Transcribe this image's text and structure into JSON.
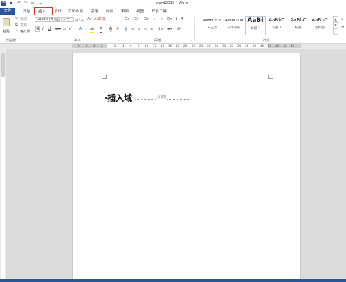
{
  "title": "word2013 - Word",
  "tabs": [
    "文件",
    "开始",
    "插入",
    "设计",
    "页面布局",
    "引用",
    "邮件",
    "审阅",
    "视图",
    "开发工具"
  ],
  "clipboard": {
    "paste": "粘贴",
    "cut": "剪切",
    "copy": "复制",
    "format_painter": "格式刷",
    "label": "剪贴板"
  },
  "font": {
    "name": "Calibri (西文正",
    "size": "二号",
    "label": "字体",
    "bold": "B",
    "italic": "I",
    "underline": "U"
  },
  "paragraph": {
    "label": "段落"
  },
  "styles": {
    "label": "样式",
    "items": [
      {
        "preview": "AaBbCcDd",
        "name": "↵正文"
      },
      {
        "preview": "AaBbCcDd",
        "name": "↵无间隔"
      },
      {
        "preview": "AaBł",
        "name": "标题 1"
      },
      {
        "preview": "AaBbC",
        "name": "标题 2"
      },
      {
        "preview": "AaBbC",
        "name": "标题"
      },
      {
        "preview": "AaBbC",
        "name": "副标题"
      }
    ]
  },
  "ruler": {
    "left_numbers": [
      "8",
      "6",
      "4",
      "2"
    ],
    "numbers": [
      "2",
      "4",
      "6",
      "8",
      "10",
      "12",
      "14",
      "16",
      "18",
      "20",
      "22",
      "24",
      "26",
      "28",
      "30",
      "32",
      "34",
      "36",
      "38",
      "40",
      "42",
      "44",
      "46",
      "48"
    ]
  },
  "document": {
    "heading": "·插入域",
    "page_break_label": "分页符"
  }
}
